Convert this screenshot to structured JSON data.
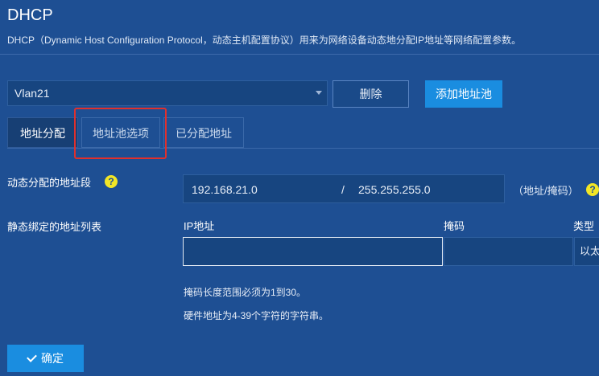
{
  "page": {
    "title": "DHCP",
    "description": "DHCP（Dynamic Host Configuration Protocol，动态主机配置协议）用来为网络设备动态地分配IP地址等网络配置参数。"
  },
  "pool_select": {
    "value": "Vlan21"
  },
  "buttons": {
    "delete": "删除",
    "add_pool": "添加地址池",
    "confirm": "确定"
  },
  "tabs": [
    {
      "label": "地址分配",
      "active": true
    },
    {
      "label": "地址池选项",
      "active": false
    },
    {
      "label": "已分配地址",
      "active": false
    }
  ],
  "dynamic_range": {
    "label": "动态分配的地址段",
    "help": "?",
    "start_ip": "192.168.21.0",
    "separator": "/",
    "mask": "255.255.255.0",
    "unit": "（地址/掩码）"
  },
  "static_binding": {
    "label": "静态绑定的地址列表",
    "columns": [
      "IP地址",
      "掩码",
      "类型"
    ],
    "row": {
      "ip": "",
      "mask": "",
      "type": "以太"
    }
  },
  "hints": [
    "掩码长度范围必须为1到30。",
    "硬件地址为4-39个字符的字符串。"
  ],
  "colors": {
    "background": "#1e4f93",
    "accent": "#1a8de0",
    "highlight_border": "#e0302d",
    "help_icon": "#f2e626"
  }
}
